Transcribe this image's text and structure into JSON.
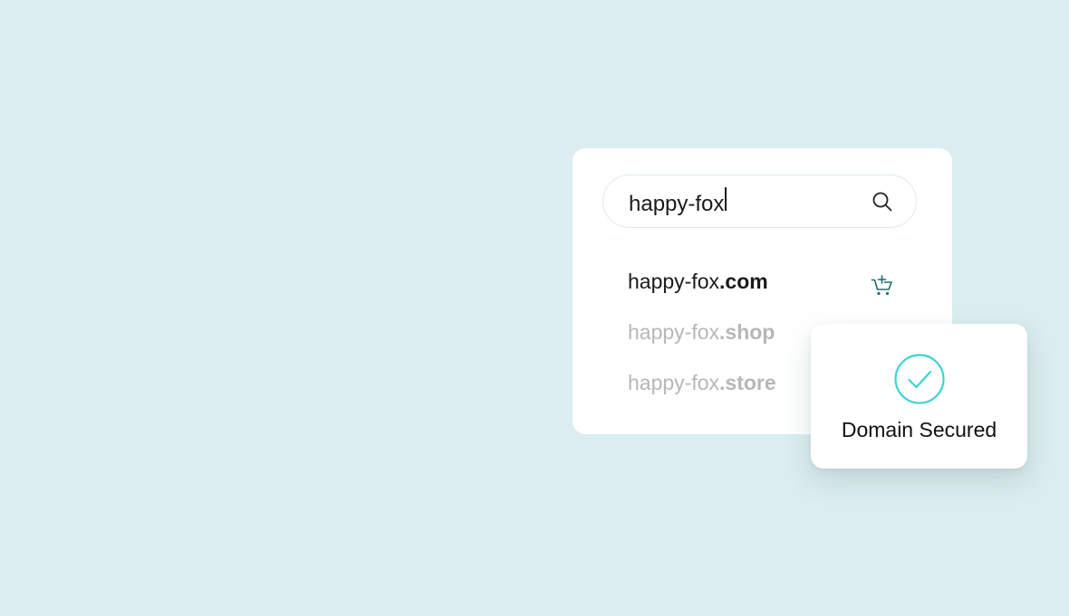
{
  "colors": {
    "background": "#dbedee",
    "accent": "#3dd3d3",
    "cart": "#1d6d73",
    "muted_text": "#b7b7b7"
  },
  "search": {
    "value": "happy-fox",
    "icon": "search-icon"
  },
  "results": [
    {
      "base": "happy-fox",
      "tld": ".com",
      "status": "available",
      "icon": "add-to-cart-icon"
    },
    {
      "base": "happy-fox",
      "tld": ".shop",
      "status": "unavailable"
    },
    {
      "base": "happy-fox",
      "tld": ".store",
      "status": "unavailable"
    }
  ],
  "secured": {
    "icon": "check-circle-icon",
    "label": "Domain Secured"
  }
}
